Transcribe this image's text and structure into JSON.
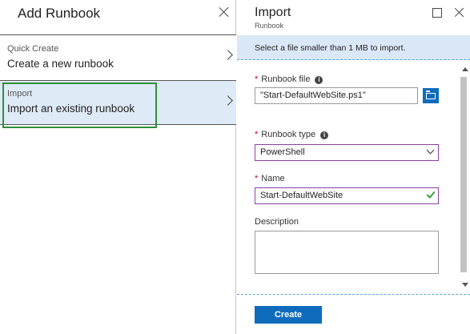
{
  "left_blade": {
    "title": "Add Runbook",
    "options": [
      {
        "small": "Quick Create",
        "big": "Create a new runbook"
      },
      {
        "small": "Import",
        "big": "Import an existing runbook"
      }
    ]
  },
  "right_blade": {
    "title": "Import",
    "subtitle": "Runbook",
    "info": "Select a file smaller than 1 MB to import.",
    "runbook_file": {
      "label": "Runbook file",
      "value": "\"Start-DefaultWebSite.ps1\""
    },
    "runbook_type": {
      "label": "Runbook type",
      "value": "PowerShell"
    },
    "name": {
      "label": "Name",
      "value": "Start-DefaultWebSite"
    },
    "description": {
      "label": "Description",
      "value": ""
    },
    "create_label": "Create"
  },
  "colors": {
    "accent": "#0f6cbd",
    "selected_bg": "#dfeaf7",
    "selection_border": "#2f8f3a",
    "focus_border": "#8b3fa6",
    "required": "#d0021b",
    "valid_check": "#3a9f3a"
  },
  "icons": [
    "close-icon",
    "chevron-right-icon",
    "maximize-icon",
    "info-icon",
    "folder-icon",
    "chevron-down-icon",
    "checkmark-icon",
    "scroll-up-icon",
    "scroll-down-icon"
  ]
}
